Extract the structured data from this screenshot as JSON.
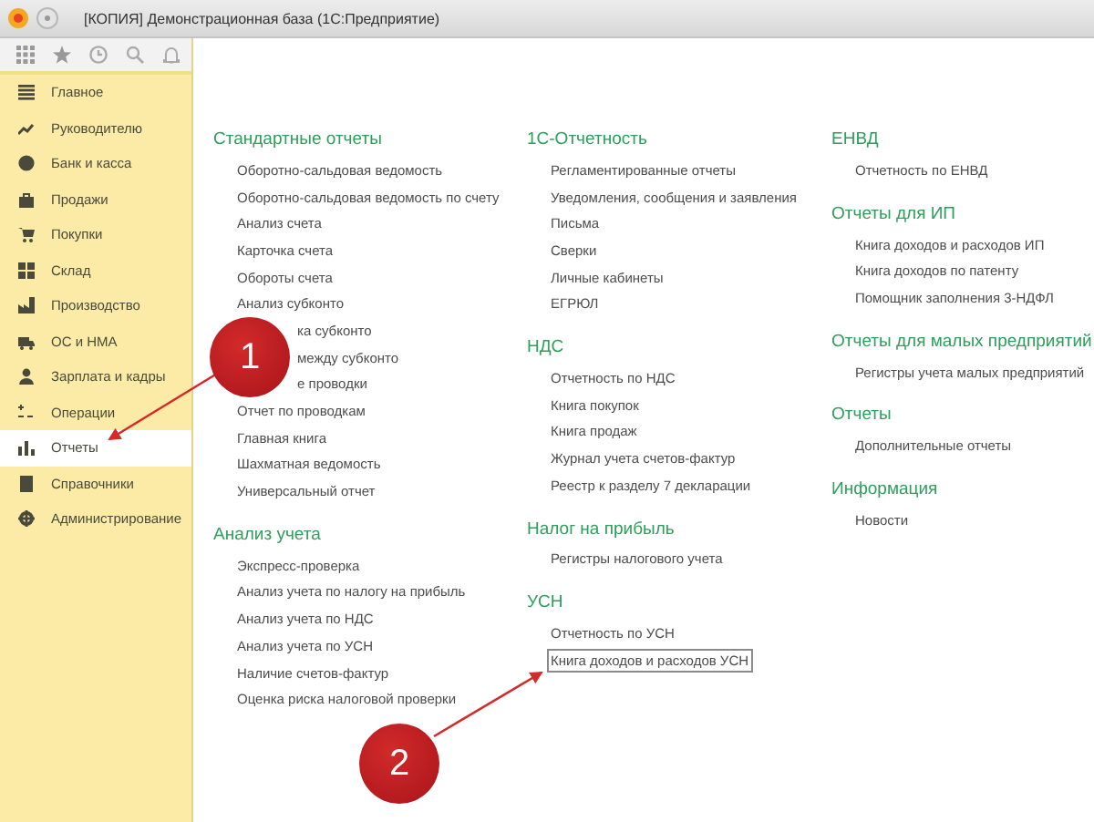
{
  "window": {
    "title": "[КОПИЯ] Демонстрационная база  (1С:Предприятие)"
  },
  "sidebar": {
    "items": [
      {
        "label": "Главное",
        "selected": false
      },
      {
        "label": "Руководителю",
        "selected": false
      },
      {
        "label": "Банк и касса",
        "selected": false
      },
      {
        "label": "Продажи",
        "selected": false
      },
      {
        "label": "Покупки",
        "selected": false
      },
      {
        "label": "Склад",
        "selected": false
      },
      {
        "label": "Производство",
        "selected": false
      },
      {
        "label": "ОС и НМА",
        "selected": false
      },
      {
        "label": "Зарплата и кадры",
        "selected": false
      },
      {
        "label": "Операции",
        "selected": false
      },
      {
        "label": "Отчеты",
        "selected": true
      },
      {
        "label": "Справочники",
        "selected": false
      },
      {
        "label": "Администрирование",
        "selected": false
      }
    ]
  },
  "columns": [
    {
      "sections": [
        {
          "title": "Стандартные отчеты",
          "items": [
            {
              "label": "Оборотно-сальдовая ведомость",
              "kind": "link",
              "focused": false
            },
            {
              "label": "Оборотно-сальдовая ведомость по счету",
              "kind": "link",
              "focused": false
            },
            {
              "label": "Анализ счета",
              "kind": "link",
              "focused": false
            },
            {
              "label": "Карточка счета",
              "kind": "link",
              "focused": false
            },
            {
              "label": "Обороты счета",
              "kind": "link",
              "focused": false
            },
            {
              "label": "Анализ субконто",
              "kind": "link",
              "focused": false
            },
            {
              "label": "ка субконто",
              "kind": "clipped",
              "focused": false
            },
            {
              "label": "между субконто",
              "kind": "clipped",
              "focused": false
            },
            {
              "label": "е проводки",
              "kind": "clipped",
              "focused": false
            },
            {
              "label": "Отчет по проводкам",
              "kind": "link",
              "focused": false
            },
            {
              "label": "Главная книга",
              "kind": "link",
              "focused": false
            },
            {
              "label": "Шахматная ведомость",
              "kind": "link",
              "focused": false
            },
            {
              "label": "Универсальный отчет",
              "kind": "link",
              "focused": false
            }
          ]
        },
        {
          "title": "Анализ учета",
          "items": [
            {
              "label": "Экспресс-проверка",
              "kind": "link",
              "focused": false
            },
            {
              "label": "Анализ учета по налогу на прибыль",
              "kind": "link",
              "focused": false
            },
            {
              "label": "Анализ учета по НДС",
              "kind": "link",
              "focused": false
            },
            {
              "label": "Анализ учета по УСН",
              "kind": "link",
              "focused": false
            },
            {
              "label": "Наличие счетов-фактур",
              "kind": "link",
              "focused": false
            },
            {
              "label": "Оценка риска налоговой проверки",
              "kind": "link",
              "focused": false
            }
          ]
        }
      ]
    },
    {
      "sections": [
        {
          "title": "1С-Отчетность",
          "items": [
            {
              "label": "Регламентированные отчеты",
              "kind": "link",
              "focused": false
            },
            {
              "label": "Уведомления, сообщения и заявления",
              "kind": "link",
              "focused": false
            },
            {
              "label": "Письма",
              "kind": "link",
              "focused": false
            },
            {
              "label": "Сверки",
              "kind": "link",
              "focused": false
            },
            {
              "label": "Личные кабинеты",
              "kind": "link",
              "focused": false
            },
            {
              "label": "ЕГРЮЛ",
              "kind": "link",
              "focused": false
            }
          ]
        },
        {
          "title": "НДС",
          "items": [
            {
              "label": "Отчетность по НДС",
              "kind": "link",
              "focused": false
            },
            {
              "label": "Книга покупок",
              "kind": "link",
              "focused": false
            },
            {
              "label": "Книга продаж",
              "kind": "link",
              "focused": false
            },
            {
              "label": "Журнал учета счетов-фактур",
              "kind": "link",
              "focused": false
            },
            {
              "label": "Реестр к разделу 7 декларации",
              "kind": "link",
              "focused": false
            }
          ]
        },
        {
          "title": "Налог на прибыль",
          "items": [
            {
              "label": "Регистры налогового учета",
              "kind": "link",
              "focused": false
            }
          ]
        },
        {
          "title": "УСН",
          "items": [
            {
              "label": "Отчетность по УСН",
              "kind": "link",
              "focused": false
            },
            {
              "label": "Книга доходов и расходов УСН",
              "kind": "link",
              "focused": true
            }
          ]
        }
      ]
    },
    {
      "sections": [
        {
          "title": "ЕНВД",
          "items": [
            {
              "label": "Отчетность по ЕНВД",
              "kind": "link",
              "focused": false
            }
          ]
        },
        {
          "title": "Отчеты для ИП",
          "items": [
            {
              "label": "Книга доходов и расходов ИП",
              "kind": "link",
              "focused": false
            },
            {
              "label": "Книга доходов по патенту",
              "kind": "link",
              "focused": false
            },
            {
              "label": "Помощник заполнения 3-НДФЛ",
              "kind": "link",
              "focused": false
            }
          ]
        },
        {
          "title": "Отчеты для малых предприятий",
          "items": [
            {
              "label": "Регистры учета малых предприятий",
              "kind": "link",
              "focused": false
            }
          ]
        },
        {
          "title": "Отчеты",
          "items": [
            {
              "label": "Дополнительные отчеты",
              "kind": "link",
              "focused": false
            }
          ]
        },
        {
          "title": "Информация",
          "items": [
            {
              "label": "Новости",
              "kind": "link",
              "focused": false
            }
          ]
        }
      ]
    }
  ],
  "callouts": [
    {
      "number": "1"
    },
    {
      "number": "2"
    }
  ]
}
